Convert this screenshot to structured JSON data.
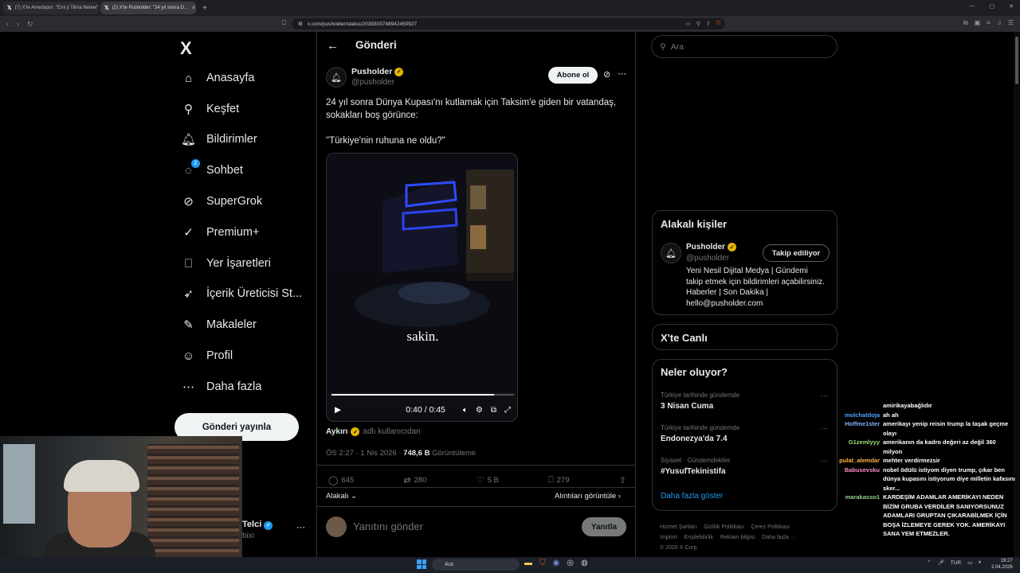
{
  "browser": {
    "tabs": [
      {
        "label": "(7) X'te Amedspor: \"Emi ji Tilma Netew\"",
        "active": false
      },
      {
        "label": "(2) X'te Pusholder: \"24 yıl sonra D...",
        "active": true
      }
    ],
    "url": "x.com/pusholder/status/2039303748942450927"
  },
  "sidebar": {
    "logo": "X",
    "items": [
      {
        "label": "Anasayfa",
        "icon": "home-icon",
        "glyph": "⌂"
      },
      {
        "label": "Keşfet",
        "icon": "search-icon",
        "glyph": "⚲"
      },
      {
        "label": "Bildirimler",
        "icon": "bell-icon",
        "glyph": "🔔︎"
      },
      {
        "label": "Sohbet",
        "icon": "chat-icon",
        "glyph": "◌",
        "badge": "2"
      },
      {
        "label": "SuperGrok",
        "icon": "grok-icon",
        "glyph": "⊘"
      },
      {
        "label": "Premium+",
        "icon": "premium-icon",
        "glyph": "✓"
      },
      {
        "label": "Yer İşaretleri",
        "icon": "bookmark-icon",
        "glyph": "⎕"
      },
      {
        "label": "İçerik Üreticisi St...",
        "icon": "rocket-icon",
        "glyph": "➶"
      },
      {
        "label": "Makaleler",
        "icon": "article-icon",
        "glyph": "✎"
      },
      {
        "label": "Profil",
        "icon": "person-icon",
        "glyph": "☺"
      },
      {
        "label": "Daha fazla",
        "icon": "more-circle-icon",
        "glyph": "⋯"
      }
    ],
    "post_button": "Gönderi yayınla",
    "account_name": "Telci",
    "account_handle": "bixi"
  },
  "post": {
    "page_title": "Gönderi",
    "author_name": "Pusholder",
    "author_handle": "@pusholder",
    "subscribe_label": "Abone ol",
    "text_line1": "24 yıl sonra Dünya Kupası'nı kutlamak için Taksim'e giden bir vatandaş, sokakları boş görünce:",
    "text_line2": "\"Türkiye'nin ruhuna ne oldu?\"",
    "video": {
      "caption": "sakin.",
      "time": "0:40 / 0:45",
      "progress": 0.89
    },
    "source_name": "Aykırı",
    "source_suffix": "adlı kullanıcıdan",
    "timestamp": "ÖS 2:27 · 1 Nis 2026 · ",
    "views_count": "748,6 B",
    "views_label": " Görüntüleme",
    "stats": {
      "replies": "645",
      "reposts": "280",
      "likes": "5 B",
      "bookmarks": "279"
    },
    "sort_label": "Alakalı",
    "quotes_label": "Alıntıları görüntüle",
    "reply_placeholder": "Yanıtını gönder",
    "reply_button": "Yanıtla"
  },
  "right": {
    "search_placeholder": "Ara",
    "related_title": "Alakalı kişiler",
    "related_person": {
      "name": "Pusholder",
      "handle": "@pusholder",
      "follow_label": "Takip ediliyor",
      "bio": "Yeni Nesil Dijital Medya | Gündemi takip etmek için bildirimleri açabilirsiniz. Haberler | Son Dakika | hello@pusholder.com"
    },
    "live_title": "X'te Canlı",
    "trends_title": "Neler oluyor?",
    "trends": [
      {
        "context": "Türkiye tarihinde gündemde",
        "title": "3 Nisan Cuma"
      },
      {
        "context": "Türkiye tarihinde gündemde",
        "title": "Endonezya'da 7.4"
      },
      {
        "context": "Siyaset · Gündemdekiler",
        "title": "#YusufTekinistifa"
      }
    ],
    "show_more": "Daha fazla göster",
    "footer": [
      "Hizmet Şartları",
      "Gizlilik Politikası",
      "Çerez Politikası",
      "Imprint",
      "Erişilebilirlik",
      "Reklam bilgisi",
      "Daha fazla ···",
      "© 2026 X Corp."
    ]
  },
  "chat": [
    {
      "user": "",
      "color": "#ffffff",
      "text": "amirikayabağlıdır"
    },
    {
      "user": "molchatdoja",
      "color": "#4aa3ff",
      "text": "ah ah"
    },
    {
      "user": "Hoffme1ster",
      "color": "#7fb3ff",
      "text": "amerikayı yenip reisin trump la taşak geçme olayı"
    },
    {
      "user": "G1zemlyyy",
      "color": "#9be07a",
      "text": "amerikanın da kadro değeri az değil 360 milyon"
    },
    {
      "user": "pulat_alemdar",
      "color": "#ffb347",
      "text": "mehter verdirmezsir"
    },
    {
      "user": "Babusevsku",
      "color": "#ff8fc8",
      "text": "nobel ödülü istiyom diyen trump, çıkar ben dünya kupasını istiyorum diye milletin kafasını sker..."
    },
    {
      "user": "marakasso1",
      "color": "#8fd18f",
      "text": "KARDEŞİM ADAMLAR AMERİKAYI NEDEN BİZİM GRUBA VERDİLER SANIYORSUNUZ ADAMLARI GRUPTAN ÇIKARABİLMEK İÇİN BOŞA İZLEMEYE GEREK YOK. AMERİKAYI SANA YEM ETMEZLER."
    }
  ],
  "taskbar": {
    "search_placeholder": "Ara",
    "lang": "TUR",
    "time": "19:27",
    "date": "2.04.2026"
  }
}
